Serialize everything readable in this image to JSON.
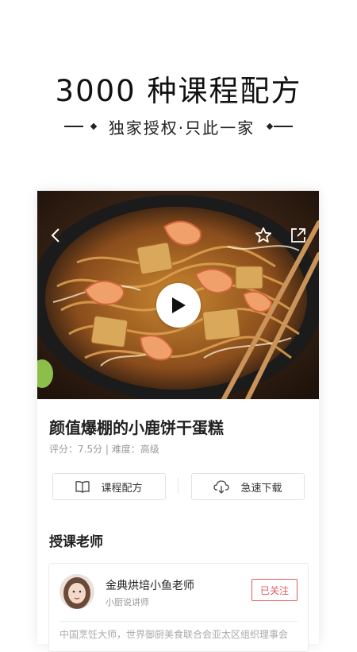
{
  "promo": {
    "headline": "3000 种课程配方",
    "subline": "独家授权·只此一家"
  },
  "recipe": {
    "title": "颜值爆棚的小鹿饼干蛋糕",
    "rating_label": "评分：",
    "rating_value": "7.5分",
    "separator": " | ",
    "difficulty_label": "难度：",
    "difficulty_value": "高级"
  },
  "actions": {
    "recipe_label": "课程配方",
    "download_label": "急速下载"
  },
  "teacher_section": {
    "title": "授课老师",
    "name": "金典烘培小鱼老师",
    "role": "小厨说讲师",
    "follow_label": "已关注",
    "description": "中国烹饪大师，世界御厨美食联合会亚太区组织理事会"
  },
  "icons": {
    "back": "chevron-left-icon",
    "favorite": "star-outline-icon",
    "share": "share-external-icon",
    "play": "play-icon",
    "book": "book-icon",
    "download": "cloud-download-icon"
  },
  "colors": {
    "accent_red": "#e25a5a",
    "text_primary": "#222222",
    "text_muted": "#999999"
  }
}
